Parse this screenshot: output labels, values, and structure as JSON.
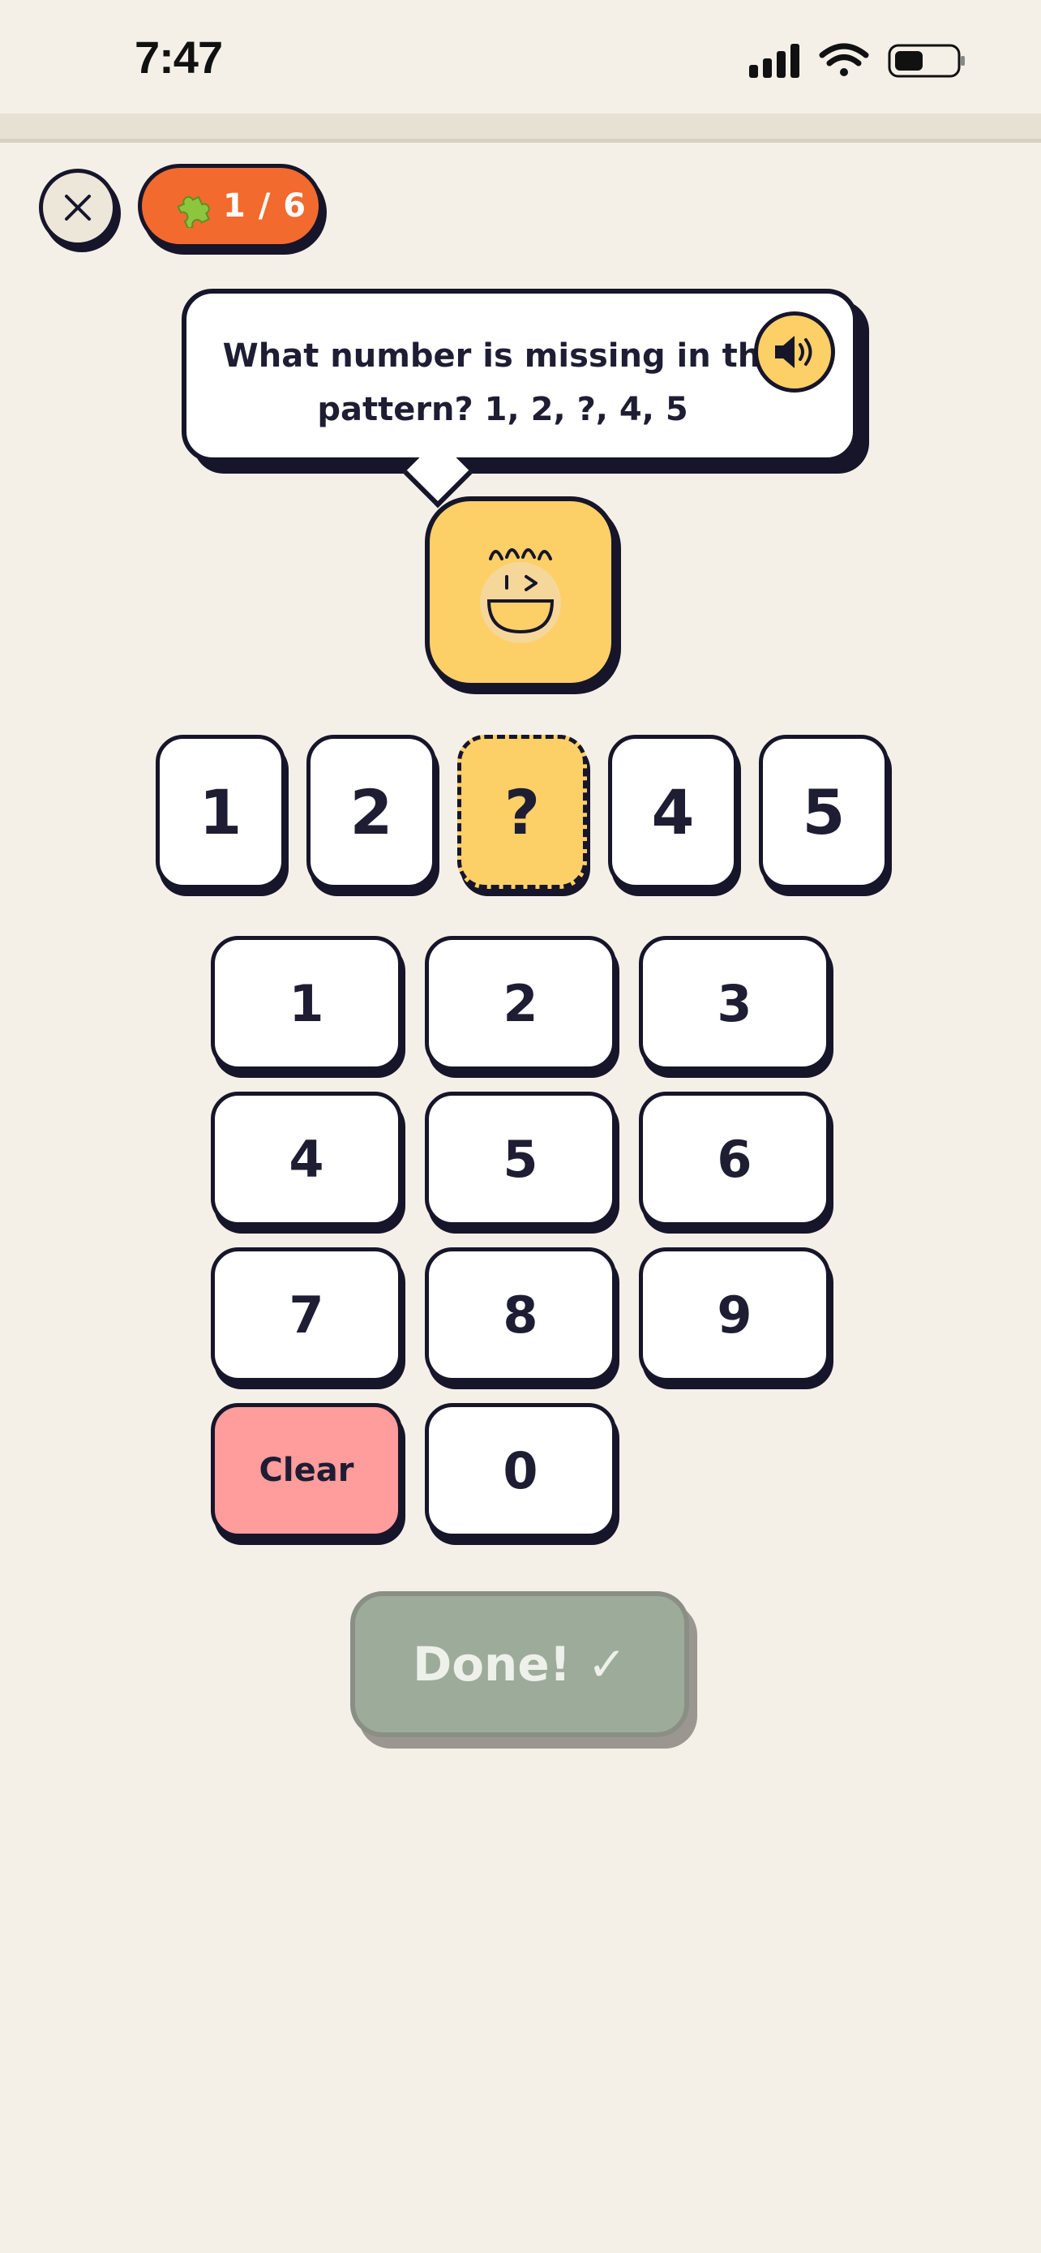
{
  "status_bar": {
    "time": "7:47"
  },
  "header": {
    "progress": "1 / 6"
  },
  "question": {
    "text": "What number is missing in the pattern? 1, 2, ?, 4, 5"
  },
  "sequence": [
    "1",
    "2",
    "?",
    "4",
    "5"
  ],
  "keypad": {
    "keys": [
      "1",
      "2",
      "3",
      "4",
      "5",
      "6",
      "7",
      "8",
      "9"
    ],
    "clear_label": "Clear",
    "zero_label": "0"
  },
  "done_label": "Done! ✓",
  "colors": {
    "background": "#f4f0e8",
    "accent_orange": "#f26a2e",
    "accent_yellow": "#fdcf67",
    "clear_red": "#ff9c9c",
    "done_disabled": "#9dab9b",
    "ink": "#16152a"
  },
  "icons": {
    "close": "close-icon",
    "progress": "puzzle-icon",
    "speaker": "speaker-icon",
    "mascot": "smiling-mascot-icon"
  }
}
